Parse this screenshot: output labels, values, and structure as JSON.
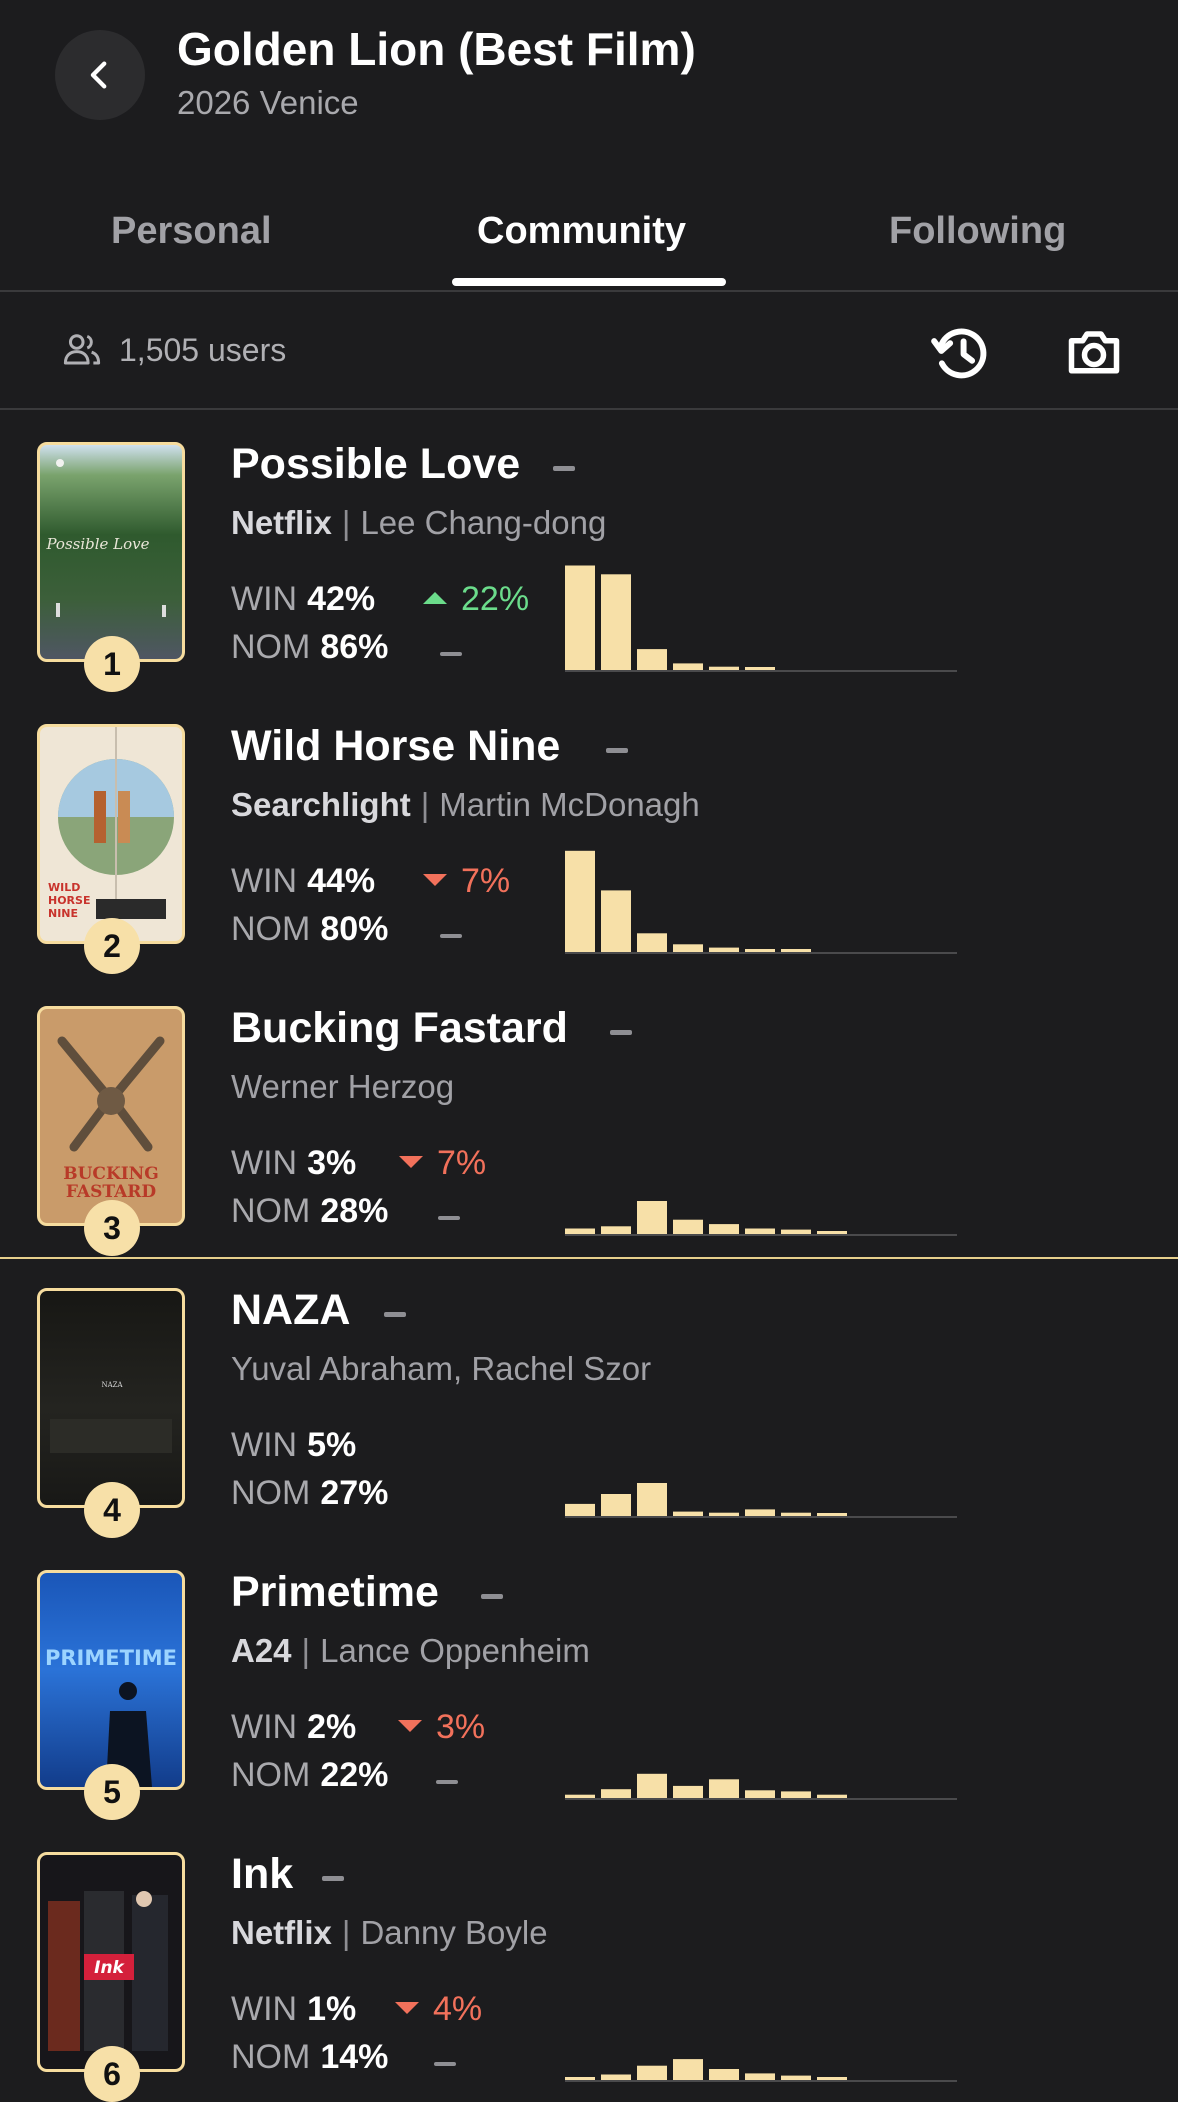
{
  "header": {
    "title": "Golden Lion (Best Film)",
    "subtitle": "2026 Venice",
    "back_icon": "chevron-left-icon"
  },
  "tabs": [
    {
      "label": "Personal",
      "active": false
    },
    {
      "label": "Community",
      "active": true
    },
    {
      "label": "Following",
      "active": false
    }
  ],
  "toolbar": {
    "users_count": "1,505 users",
    "users_icon": "users-icon",
    "history_icon": "history-icon",
    "camera_icon": "camera-icon"
  },
  "colors": {
    "background": "#1c1c1e",
    "accent": "#f7e0a8",
    "up": "#6bdc8b",
    "down": "#f2715b"
  },
  "films": [
    {
      "rank": "1",
      "title": "Possible Love",
      "studio": "Netflix",
      "director": "Lee Chang-dong",
      "win": "42%",
      "win_change": "22%",
      "win_direction": "up",
      "nom": "86%",
      "distribution": [
        0.95,
        0.87,
        0.19,
        0.06,
        0.03,
        0.02,
        0.0,
        0.0,
        0.0,
        0.0,
        0.0
      ]
    },
    {
      "rank": "2",
      "title": "Wild Horse Nine",
      "studio": "Searchlight",
      "director": "Martin McDonagh",
      "win": "44%",
      "win_change": "7%",
      "win_direction": "down",
      "nom": "80%",
      "distribution": [
        0.92,
        0.56,
        0.17,
        0.07,
        0.04,
        0.02,
        0.01,
        0.0,
        0.0,
        0.0,
        0.0
      ]
    },
    {
      "rank": "3",
      "title": "Bucking Fastard",
      "studio": "",
      "director": "Werner Herzog",
      "win": "3%",
      "win_change": "7%",
      "win_direction": "down",
      "nom": "28%",
      "distribution": [
        0.05,
        0.07,
        0.3,
        0.13,
        0.09,
        0.05,
        0.04,
        0.02,
        0.0,
        0.0,
        0.0
      ]
    },
    {
      "rank": "4",
      "title": "NAZA",
      "studio": "",
      "director": "Yuval Abraham, Rachel Szor",
      "win": "5%",
      "win_change": "",
      "win_direction": "none",
      "nom": "27%",
      "distribution": [
        0.11,
        0.2,
        0.3,
        0.04,
        0.03,
        0.06,
        0.03,
        0.02,
        0.0,
        0.0,
        0.0
      ]
    },
    {
      "rank": "5",
      "title": "Primetime",
      "studio": "A24",
      "director": "Lance Oppenheim",
      "win": "2%",
      "win_change": "3%",
      "win_direction": "down",
      "nom": "22%",
      "distribution": [
        0.03,
        0.08,
        0.22,
        0.11,
        0.17,
        0.07,
        0.06,
        0.03,
        0.0,
        0.0,
        0.0
      ]
    },
    {
      "rank": "6",
      "title": "Ink",
      "studio": "Netflix",
      "director": "Danny Boyle",
      "win": "1%",
      "win_change": "4%",
      "win_direction": "down",
      "nom": "14%",
      "distribution": [
        0.02,
        0.05,
        0.13,
        0.19,
        0.1,
        0.06,
        0.04,
        0.02,
        0.0,
        0.0,
        0.0
      ]
    }
  ]
}
